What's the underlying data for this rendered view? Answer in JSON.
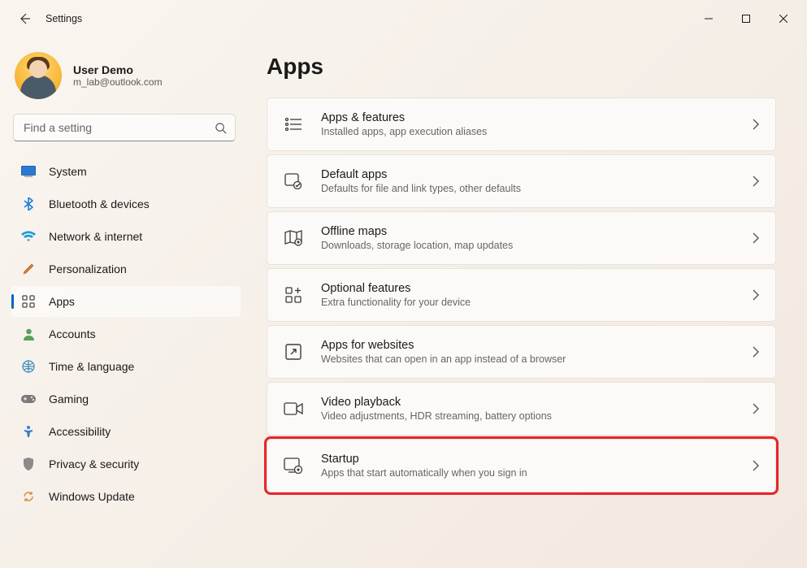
{
  "window": {
    "title": "Settings"
  },
  "user": {
    "name": "User Demo",
    "email": "m_lab@outlook.com"
  },
  "search": {
    "placeholder": "Find a setting"
  },
  "nav": {
    "items": [
      {
        "label": "System"
      },
      {
        "label": "Bluetooth & devices"
      },
      {
        "label": "Network & internet"
      },
      {
        "label": "Personalization"
      },
      {
        "label": "Apps"
      },
      {
        "label": "Accounts"
      },
      {
        "label": "Time & language"
      },
      {
        "label": "Gaming"
      },
      {
        "label": "Accessibility"
      },
      {
        "label": "Privacy & security"
      },
      {
        "label": "Windows Update"
      }
    ],
    "selected_index": 4
  },
  "page": {
    "title": "Apps",
    "cards": [
      {
        "title": "Apps & features",
        "subtitle": "Installed apps, app execution aliases"
      },
      {
        "title": "Default apps",
        "subtitle": "Defaults for file and link types, other defaults"
      },
      {
        "title": "Offline maps",
        "subtitle": "Downloads, storage location, map updates"
      },
      {
        "title": "Optional features",
        "subtitle": "Extra functionality for your device"
      },
      {
        "title": "Apps for websites",
        "subtitle": "Websites that can open in an app instead of a browser"
      },
      {
        "title": "Video playback",
        "subtitle": "Video adjustments, HDR streaming, battery options"
      },
      {
        "title": "Startup",
        "subtitle": "Apps that start automatically when you sign in"
      }
    ],
    "highlighted_index": 6
  }
}
